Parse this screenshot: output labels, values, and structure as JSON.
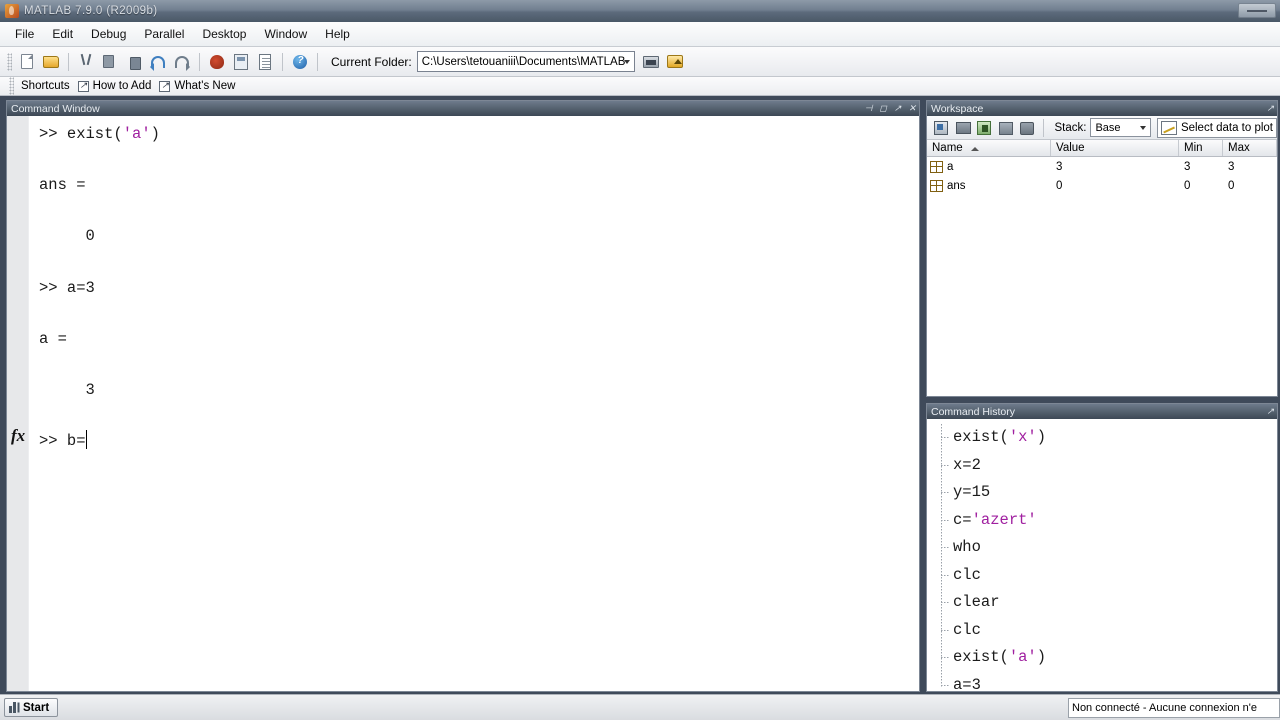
{
  "window": {
    "title": "MATLAB 7.9.0 (R2009b)",
    "app_icon": "matlab-icon"
  },
  "menubar": {
    "items": [
      {
        "label": "File"
      },
      {
        "label": "Edit"
      },
      {
        "label": "Debug"
      },
      {
        "label": "Parallel"
      },
      {
        "label": "Desktop"
      },
      {
        "label": "Window"
      },
      {
        "label": "Help"
      }
    ]
  },
  "toolbar": {
    "buttons": [
      {
        "name": "new-file-icon"
      },
      {
        "name": "open-file-icon"
      },
      {
        "name": "cut-icon"
      },
      {
        "name": "copy-icon"
      },
      {
        "name": "paste-icon"
      },
      {
        "name": "undo-icon"
      },
      {
        "name": "redo-icon"
      },
      {
        "name": "simulink-icon"
      },
      {
        "name": "guide-icon"
      },
      {
        "name": "profiler-icon"
      },
      {
        "name": "help-icon"
      }
    ],
    "current_folder_label": "Current Folder:",
    "current_folder_value": "C:\\Users\\tetouaniii\\Documents\\MATLAB",
    "browse_button": "browse-folder-icon",
    "up_button": "up-one-level-icon"
  },
  "shortcuts_bar": {
    "label": "Shortcuts",
    "items": [
      {
        "label": "How to Add"
      },
      {
        "label": "What's New"
      }
    ]
  },
  "command_window": {
    "title": "Command Window",
    "titlebar_buttons": [
      "dock-icon",
      "maximize-icon",
      "undock-icon",
      "close-icon"
    ],
    "lines": [
      {
        "segments": [
          {
            "text": ">> exist(",
            "kind": "plain"
          },
          {
            "text": "'a'",
            "kind": "string"
          },
          {
            "text": ")",
            "kind": "plain"
          }
        ]
      },
      {
        "segments": [
          {
            "text": "",
            "kind": "plain"
          }
        ]
      },
      {
        "segments": [
          {
            "text": "ans =",
            "kind": "plain"
          }
        ]
      },
      {
        "segments": [
          {
            "text": "",
            "kind": "plain"
          }
        ]
      },
      {
        "segments": [
          {
            "text": "     0",
            "kind": "plain"
          }
        ]
      },
      {
        "segments": [
          {
            "text": "",
            "kind": "plain"
          }
        ]
      },
      {
        "segments": [
          {
            "text": ">> a=3",
            "kind": "plain"
          }
        ]
      },
      {
        "segments": [
          {
            "text": "",
            "kind": "plain"
          }
        ]
      },
      {
        "segments": [
          {
            "text": "a =",
            "kind": "plain"
          }
        ]
      },
      {
        "segments": [
          {
            "text": "",
            "kind": "plain"
          }
        ]
      },
      {
        "segments": [
          {
            "text": "     3",
            "kind": "plain"
          }
        ]
      },
      {
        "segments": [
          {
            "text": "",
            "kind": "plain"
          }
        ]
      }
    ],
    "prompt_line": ">> b=",
    "fx_marker": "fx",
    "has_caret": true
  },
  "workspace": {
    "title": "Workspace",
    "toolbar_buttons": [
      {
        "name": "new-variable-icon"
      },
      {
        "name": "open-variable-icon"
      },
      {
        "name": "import-data-icon"
      },
      {
        "name": "save-workspace-icon"
      },
      {
        "name": "delete-variable-icon"
      }
    ],
    "stack_label": "Stack:",
    "stack_value": "Base",
    "plot_button_label": "Select data to plot",
    "columns": [
      "Name",
      "Value",
      "Min",
      "Max"
    ],
    "sorted_column": "Name",
    "sort_direction": "ascending",
    "rows": [
      {
        "name": "a",
        "value": "3",
        "min": "3",
        "max": "3"
      },
      {
        "name": "ans",
        "value": "0",
        "min": "0",
        "max": "0"
      }
    ]
  },
  "command_history": {
    "title": "Command History",
    "entries": [
      {
        "segments": [
          {
            "text": "exist(",
            "kind": "plain"
          },
          {
            "text": "'x'",
            "kind": "string"
          },
          {
            "text": ")",
            "kind": "plain"
          }
        ]
      },
      {
        "segments": [
          {
            "text": "x=2",
            "kind": "plain"
          }
        ]
      },
      {
        "segments": [
          {
            "text": "y=15",
            "kind": "plain"
          }
        ]
      },
      {
        "segments": [
          {
            "text": "c=",
            "kind": "plain"
          },
          {
            "text": "'azert'",
            "kind": "string"
          }
        ]
      },
      {
        "segments": [
          {
            "text": "who",
            "kind": "plain"
          }
        ]
      },
      {
        "segments": [
          {
            "text": "clc",
            "kind": "plain"
          }
        ]
      },
      {
        "segments": [
          {
            "text": "clear",
            "kind": "plain"
          }
        ]
      },
      {
        "segments": [
          {
            "text": "clc",
            "kind": "plain"
          }
        ]
      },
      {
        "segments": [
          {
            "text": "exist(",
            "kind": "plain"
          },
          {
            "text": "'a'",
            "kind": "string"
          },
          {
            "text": ")",
            "kind": "plain"
          }
        ]
      },
      {
        "segments": [
          {
            "text": "a=3",
            "kind": "plain"
          }
        ]
      }
    ]
  },
  "statusbar": {
    "start_label": "Start",
    "connection_status": "Non connecté - Aucune connexion n'e"
  },
  "colors": {
    "string_literal": "#a020a0",
    "panel_title_active": "#55626f",
    "workspace_var_icon": "#d9ab26"
  }
}
